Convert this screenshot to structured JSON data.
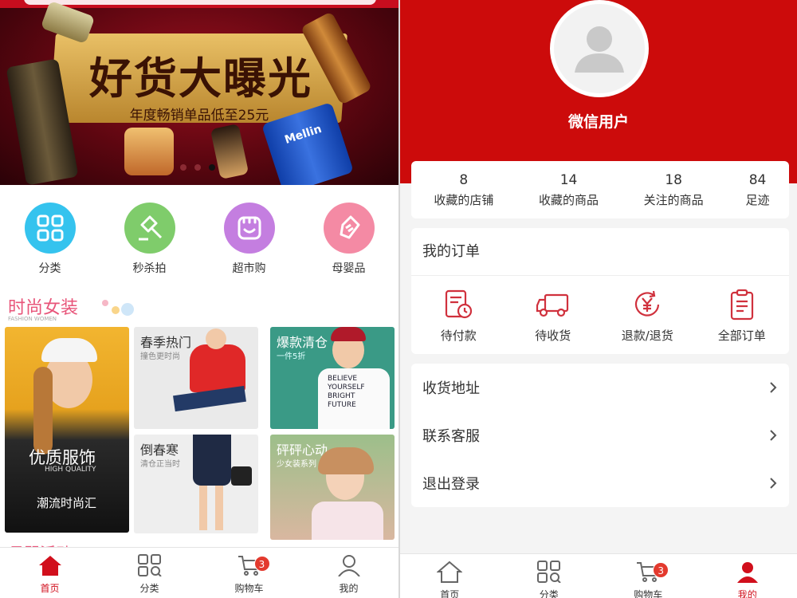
{
  "left": {
    "banner": {
      "headline": "好货大曝光",
      "sub": "年度畅销单品低至25元",
      "product_text": "Mellin"
    },
    "categories": [
      {
        "label": "分类",
        "color": "#35c3ee"
      },
      {
        "label": "秒杀拍",
        "color": "#7fcc6b"
      },
      {
        "label": "超市购",
        "color": "#c47ee0"
      },
      {
        "label": "母婴品",
        "color": "#f48aa4"
      }
    ],
    "section": {
      "title": "时尚女装",
      "subtitle": "FASHION WOMEN"
    },
    "tiles": {
      "big": {
        "title": "优质服饰",
        "en": "HIGH QUALITY",
        "sub": "潮流时尚汇"
      },
      "t1": {
        "title": "春季热门",
        "sub": "撞色更时尚"
      },
      "t2": {
        "title": "爆款清仓",
        "sub": "一件5折"
      },
      "t3": {
        "title": "倒春寒",
        "sub": "清仓正当时"
      },
      "t4": {
        "title": "砰砰心动",
        "sub": "少女装系列"
      },
      "shirt": [
        "BELIEVE",
        "YOURSELF",
        "BRIGHT",
        "FUTURE"
      ]
    },
    "next_title": "母婴活动",
    "tabbar": [
      {
        "label": "首页",
        "icon": "home-icon",
        "active": true
      },
      {
        "label": "分类",
        "icon": "grid-icon"
      },
      {
        "label": "购物车",
        "icon": "cart-icon",
        "badge": "3"
      },
      {
        "label": "我的",
        "icon": "user-icon"
      }
    ]
  },
  "right": {
    "username": "微信用户",
    "stats": [
      {
        "num": "8",
        "label": "收藏的店铺"
      },
      {
        "num": "14",
        "label": "收藏的商品"
      },
      {
        "num": "18",
        "label": "关注的商品"
      },
      {
        "num": "84",
        "label": "足迹"
      }
    ],
    "orders": {
      "title": "我的订单",
      "items": [
        {
          "label": "待付款",
          "icon": "pending-payment-icon"
        },
        {
          "label": "待收货",
          "icon": "delivery-truck-icon"
        },
        {
          "label": "退款/退货",
          "icon": "refund-icon"
        },
        {
          "label": "全部订单",
          "icon": "clipboard-icon"
        }
      ]
    },
    "menu": [
      {
        "label": "收货地址"
      },
      {
        "label": "联系客服"
      },
      {
        "label": "退出登录"
      }
    ],
    "tabbar": [
      {
        "label": "首页",
        "icon": "home-icon"
      },
      {
        "label": "分类",
        "icon": "grid-icon"
      },
      {
        "label": "购物车",
        "icon": "cart-icon",
        "badge": "3"
      },
      {
        "label": "我的",
        "icon": "user-icon",
        "active": true
      }
    ]
  },
  "colors": {
    "brand_red": "#cc0b0b",
    "accent_pink": "#e8557a",
    "badge_red": "#e33a2e"
  }
}
